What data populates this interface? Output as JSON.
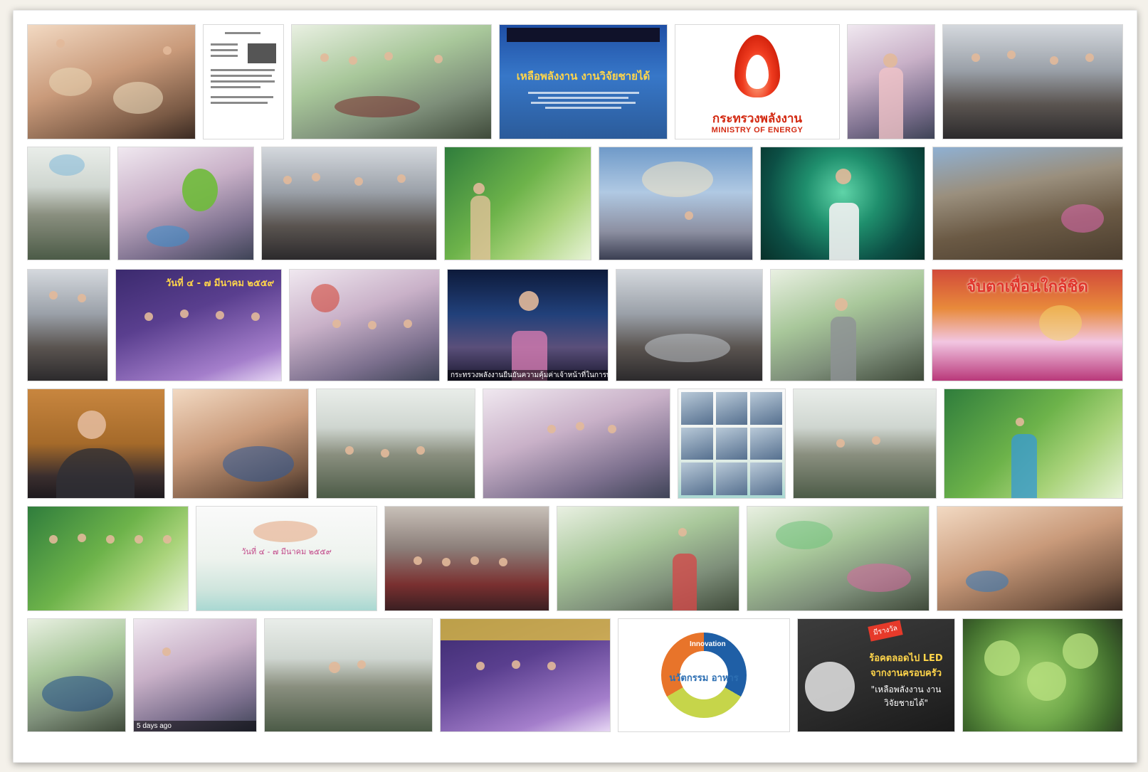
{
  "colors": {
    "page_background": "#f4f1ea",
    "paper": "#ffffff",
    "ministry_red": "#d32a12"
  },
  "tiles": {
    "energy_fair_poster_title": "เหลือพลังงาน งานวิจัยชายได้",
    "ministry_name_th": "กระทรวงพลังงาน",
    "ministry_name_en": "MINISTRY OF ENERGY",
    "orchid_banner_title": "จับตาเพื่อนใกล้ชิด",
    "event_date_th": "วันที่ ๔ - ๗ มีนาคม ๒๕๕๙",
    "white_banner_date": "วันที่ ๔ - ๗ มีนาคม ๒๕๕๙",
    "news_caption": "กระทรวงพลังงานยืนยันความคุ้มค่าเจ้าหน้าที่ในการทำงานครบรอบ",
    "innovation_center": "นวัตกรรม อาหาร",
    "innovation_top": "Innovation",
    "led_headline": "ร้อคตลอดไป LED จากงานครอบครัว",
    "led_quote": "\"เหลือพลังงาน งานวิจัยชายได้\"",
    "led_tag": "มีรางวัล",
    "days_ago": "5 days ago"
  }
}
